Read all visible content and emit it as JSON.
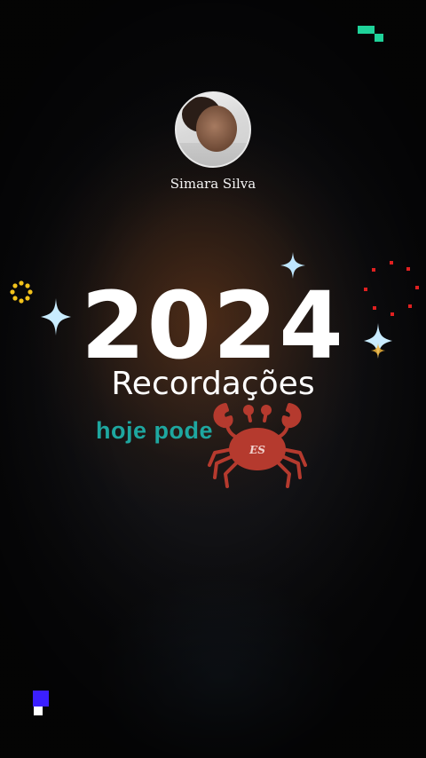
{
  "profile": {
    "name": "Simara Silva"
  },
  "headline": {
    "year": "2024",
    "title": "Recordações"
  },
  "caption": "hoje pode",
  "sticker": {
    "label": "ES",
    "icon": "crab-icon"
  },
  "colors": {
    "year_text": "#ffffff",
    "caption": "#1ea7a0",
    "sparkle": "#bfe6ff",
    "crab": "#b53a2e",
    "dots_red": "#e02020",
    "ring_yellow": "#f2c21b",
    "corner_green": "#1fd39a",
    "corner_blue": "#3b1fff"
  }
}
